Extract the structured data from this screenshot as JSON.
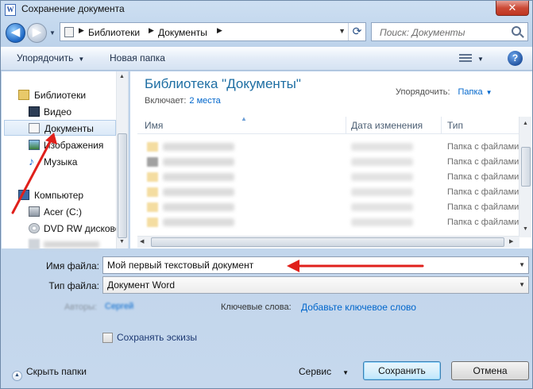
{
  "window": {
    "title": "Сохранение документа",
    "title_icon_letter": "W",
    "close_label": "✕"
  },
  "address": {
    "breadcrumbs": [
      "Библиотеки",
      "Документы"
    ],
    "search_placeholder": "Поиск: Документы"
  },
  "toolbar": {
    "organize_label": "Упорядочить",
    "new_folder_label": "Новая папка",
    "help_label": "?"
  },
  "sidebar": {
    "items": [
      {
        "label": "Библиотеки",
        "icon": "libraries-icon"
      },
      {
        "label": "Видео",
        "icon": "video-icon"
      },
      {
        "label": "Документы",
        "icon": "documents-icon",
        "selected": true
      },
      {
        "label": "Изображения",
        "icon": "pictures-icon"
      },
      {
        "label": "Музыка",
        "icon": "music-icon"
      },
      {
        "label": "Компьютер",
        "icon": "computer-icon"
      },
      {
        "label": "Acer (C:)",
        "icon": "drive-icon"
      },
      {
        "label": "DVD RW дисково",
        "icon": "dvd-icon"
      }
    ]
  },
  "content": {
    "library_title": "Библиотека \"Документы\"",
    "includes_label": "Включает:",
    "includes_link": "2 места",
    "arrange_label": "Упорядочить:",
    "arrange_value": "Папка",
    "columns": {
      "name": "Имя",
      "date": "Дата изменения",
      "type": "Тип"
    },
    "rows": [
      {
        "type": "Папка с файлами"
      },
      {
        "type": "Папка с файлами"
      },
      {
        "type": "Папка с файлами"
      },
      {
        "type": "Папка с файлами"
      },
      {
        "type": "Папка с файлами"
      },
      {
        "type": "Папка с файлами"
      }
    ]
  },
  "form": {
    "filename_label": "Имя файла:",
    "filename_value": "Мой первый текстовый документ",
    "filetype_label": "Тип файла:",
    "filetype_value": "Документ Word",
    "authors_label": "Авторы:",
    "authors_value": "Сергей",
    "keywords_label": "Ключевые слова:",
    "keywords_link": "Добавьте ключевое слово",
    "thumbnails_label": "Сохранять эскизы",
    "hide_folders_label": "Скрыть папки",
    "service_label": "Сервис",
    "save_label": "Сохранить",
    "cancel_label": "Отмена"
  },
  "colors": {
    "annotation_arrow": "#e0201b",
    "library_title": "#1e6ea3",
    "link": "#0066cc"
  }
}
